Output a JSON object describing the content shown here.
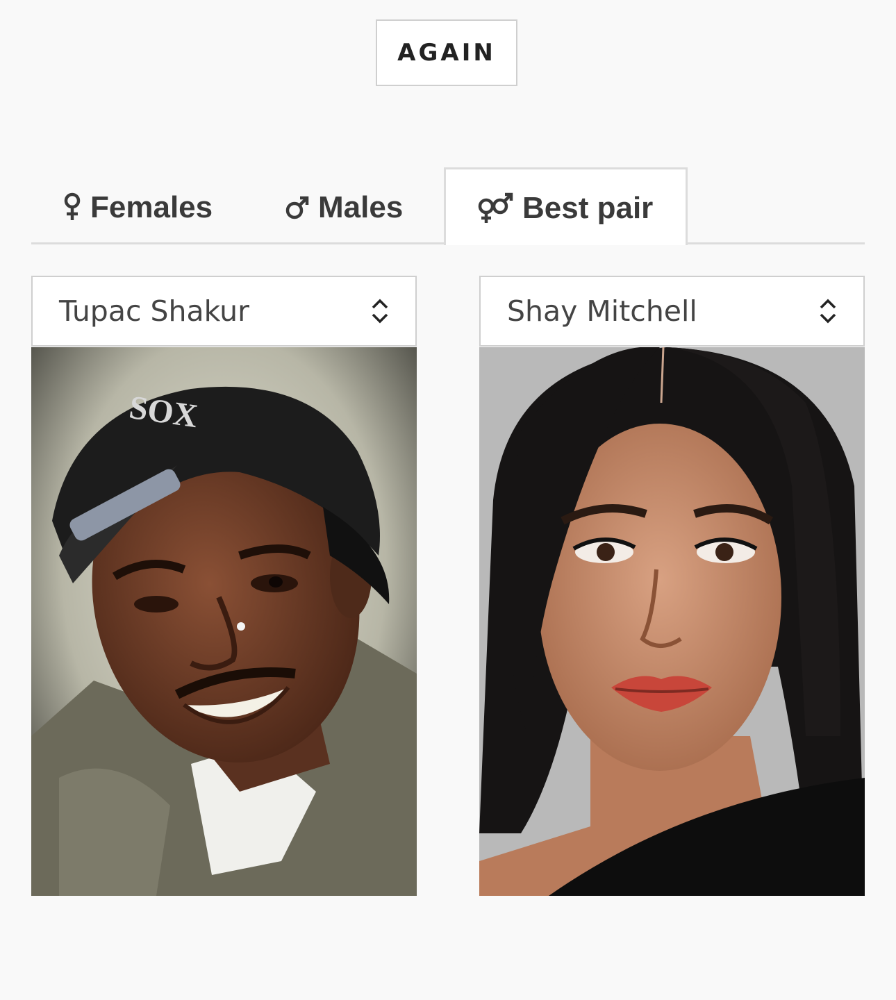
{
  "again_button": {
    "label": "AGAIN"
  },
  "tabs": [
    {
      "label": "Females",
      "icon": "female-symbol-icon"
    },
    {
      "label": "Males",
      "icon": "male-symbol-icon"
    },
    {
      "label": "Best pair",
      "icon": "gender-pair-icon",
      "active": true
    }
  ],
  "selects": [
    {
      "value": "Tupac Shakur",
      "icon": "chevron-up-down-icon"
    },
    {
      "value": "Shay Mitchell",
      "icon": "chevron-up-down-icon"
    }
  ],
  "photos": [
    {
      "alt": "Tupac Shakur",
      "colors": {
        "bg": "#c9c8b8",
        "skin": "#6b3c26",
        "cap": "#1c1c1c",
        "hoodie": "#6c6a5a"
      }
    },
    {
      "alt": "Shay Mitchell",
      "colors": {
        "bg": "#b9b9b9",
        "skin": "#c88f6f",
        "hair": "#161414",
        "lips": "#c8463a"
      }
    }
  ]
}
